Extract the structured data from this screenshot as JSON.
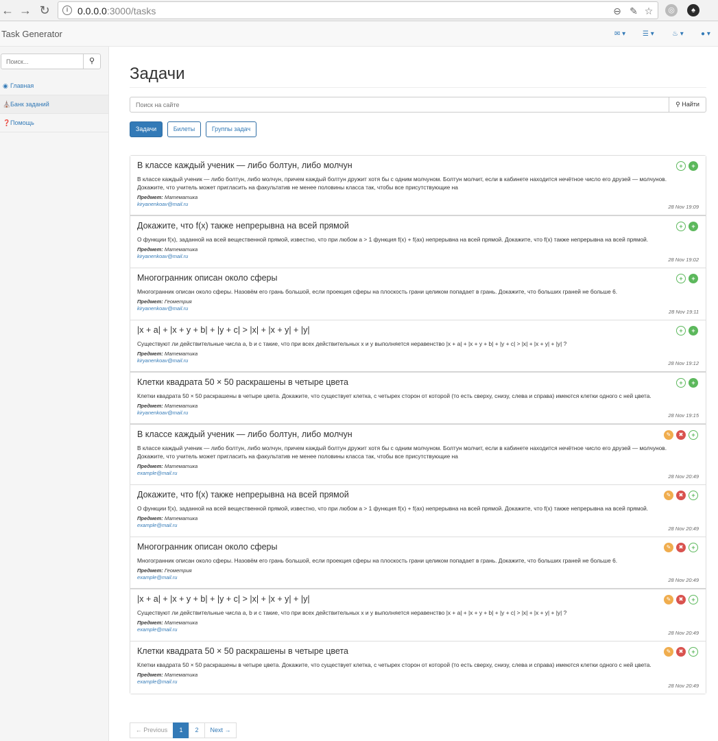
{
  "browser": {
    "url_host": "0.0.0.0",
    "url_path": ":3000/tasks",
    "icons": [
      "back-icon",
      "forward-icon",
      "reload-icon",
      "info-icon",
      "zoom-icon",
      "paint-icon",
      "star-icon",
      "globe-icon",
      "evernote-icon"
    ]
  },
  "app": {
    "brand": "Task Generator",
    "topbar_icons": [
      "envelope-icon",
      "tasks-icon",
      "bell-icon",
      "user-icon"
    ]
  },
  "sidebar": {
    "search_placeholder": "Поиск...",
    "items": [
      {
        "label": "Главная",
        "icon": "dashboard-icon"
      },
      {
        "label": "Банк заданий",
        "icon": "bank-icon"
      },
      {
        "label": "Помощь",
        "icon": "question-icon"
      }
    ]
  },
  "main": {
    "title": "Задачи",
    "search_placeholder": "Поиск на сайте",
    "search_button": "Найти",
    "tabs": [
      {
        "label": "Задачи",
        "active": true
      },
      {
        "label": "Билеты",
        "active": false
      },
      {
        "label": "Группы задач",
        "active": false
      }
    ]
  },
  "subject_label": "Предмет:",
  "tasks": [
    {
      "title": "В классе каждый ученик — либо болтун, либо молчун",
      "text": "В классе каждый ученик — либо болтун, либо молчун, причем каждый болтун дружит хотя бы с одним молчуном. Болтун молчит, если в кабинете находится нечётное число его друзей — молчунов. Докажите, что учитель может пригласить на факультатив не менее половины класса так, чтобы все присутствующие на",
      "subject": "Математика",
      "email": "kiryanenkoav@mail.ru",
      "date": "28 Nov 19:09",
      "actions": [
        "add-outline",
        "add"
      ]
    },
    {
      "title": "Докажите, что f(x) также непрерывна на всей прямой",
      "text": "О функции f(x), заданной на всей вещественной прямой, известно, что при любом a > 1 функция f(x) + f(ax) непрерывна на всей прямой. Докажите, что f(x) также непрерывна на всей прямой.",
      "subject": "Математика",
      "email": "kiryanenkoav@mail.ru",
      "date": "28 Nov 19:02",
      "actions": [
        "add-outline",
        "add"
      ]
    },
    {
      "title": "Многогранник описан около сферы",
      "text": "Многогранник описан около сферы. Назовём его грань большой, если проекция сферы на плоскость грани целиком попадает в грань. Докажите, что больших граней не больше 6.",
      "subject": "Геометрия",
      "email": "kiryanenkoav@mail.ru",
      "date": "28 Nov 19:11",
      "actions": [
        "add-outline",
        "add"
      ]
    },
    {
      "title": "|x + a| + |x + y + b| + |y + c|  >  |x| + |x + y| + |y|",
      "text": "Существуют ли действительные числа a, b и c такие, что при всех действительных x и y выполняется неравенство |x + a| + |x + y + b| + |y + c| > |x| + |x + y| + |y| ?",
      "subject": "Математика",
      "email": "kiryanenkoav@mail.ru",
      "date": "28 Nov 19:12",
      "actions": [
        "add-outline",
        "add"
      ]
    },
    {
      "title": "Клетки квадрата 50 × 50 раскрашены в четыре цвета",
      "text": "Клетки квадрата 50 × 50 раскрашены в четыре цвета. Докажите, что существует клетка, с четырех сторон от которой (то есть сверху, снизу, слева и справа) имеются клетки одного с ней цвета.",
      "subject": "Математика",
      "email": "kiryanenkoav@mail.ru",
      "date": "28 Nov 19:15",
      "actions": [
        "add-outline",
        "add"
      ]
    },
    {
      "title": "В классе каждый ученик — либо болтун, либо молчун",
      "text": "В классе каждый ученик — либо болтун, либо молчун, причем каждый болтун дружит хотя бы с одним молчуном. Болтун молчит, если в кабинете находится нечётное число его друзей — молчунов. Докажите, что учитель может пригласить на факультатив не менее половины класса так, чтобы все присутствующие на",
      "subject": "Математика",
      "email": "example@mail.ru",
      "date": "28 Nov 20:49",
      "actions": [
        "edit",
        "delete",
        "add-outline"
      ]
    },
    {
      "title": "Докажите, что f(x) также непрерывна на всей прямой",
      "text": "О функции f(x), заданной на всей вещественной прямой, известно, что при любом a > 1 функция f(x) + f(ax) непрерывна на всей прямой. Докажите, что f(x) также непрерывна на всей прямой.",
      "subject": "Математика",
      "email": "example@mail.ru",
      "date": "28 Nov 20:49",
      "actions": [
        "edit",
        "delete",
        "add-outline"
      ]
    },
    {
      "title": "Многогранник описан около сферы",
      "text": "Многогранник описан около сферы. Назовём его грань большой, если проекция сферы на плоскость грани целиком попадает в грань. Докажите, что больших граней не больше 6.",
      "subject": "Геометрия",
      "email": "example@mail.ru",
      "date": "28 Nov 20:49",
      "actions": [
        "edit",
        "delete",
        "add-outline"
      ]
    },
    {
      "title": "|x + a| + |x + y + b| + |y + c|  >  |x| + |x + y| + |y|",
      "text": "Существуют ли действительные числа a, b и c такие, что при всех действительных x и y выполняется неравенство |x + a| + |x + y + b| + |y + c| > |x| + |x + y| + |y| ?",
      "subject": "Математика",
      "email": "example@mail.ru",
      "date": "28 Nov 20:49",
      "actions": [
        "edit",
        "delete",
        "add-outline"
      ]
    },
    {
      "title": "Клетки квадрата 50 × 50 раскрашены в четыре цвета",
      "text": "Клетки квадрата 50 × 50 раскрашены в четыре цвета. Докажите, что существует клетка, с четырех сторон от которой (то есть сверху, снизу, слева и справа) имеются клетки одного с ней цвета.",
      "subject": "Математика",
      "email": "example@mail.ru",
      "date": "28 Nov 20:49",
      "actions": [
        "edit",
        "delete",
        "add-outline"
      ]
    }
  ],
  "pagination": {
    "prev": "← Previous",
    "pages": [
      "1",
      "2"
    ],
    "current": "1",
    "next": "Next →"
  },
  "colors": {
    "primary": "#337ab7",
    "success": "#5cb85c",
    "warning": "#f0ad4e",
    "danger": "#d9534f"
  }
}
